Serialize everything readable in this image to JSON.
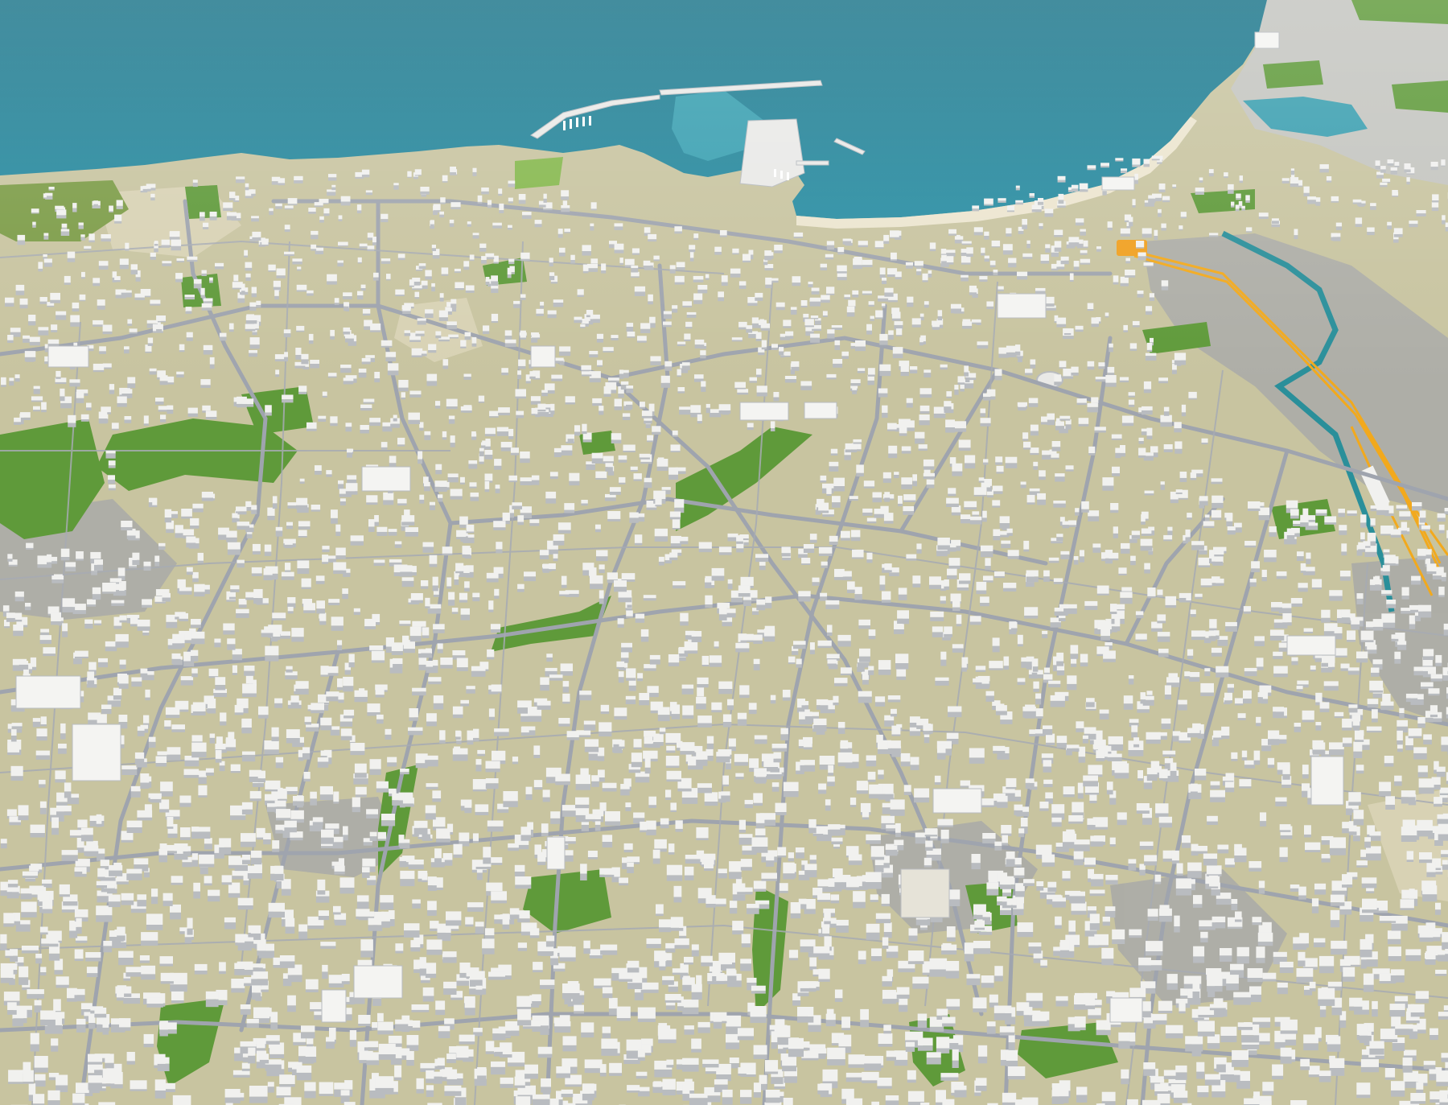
{
  "scene": {
    "kind": "3d-city-model-aerial-view",
    "colors": {
      "sea": "#1f7f95",
      "sea_shallow": "#3fa6b6",
      "land": "#c8c4a0",
      "land_light": "#d8d2b4",
      "gray_zone": "#a9aaa8",
      "road": "#9fa4ae",
      "building": "#f1f1ef",
      "building_shadow": "#b9bcc0",
      "park": "#5f9a3a",
      "park_light": "#86b84e",
      "beach": "#ece5cf",
      "river": "#2a8f9a",
      "rail": "#f2a91d",
      "stadium_roof": "#f0a020"
    },
    "features": [
      "sea",
      "coastline",
      "harbor-piers",
      "marina",
      "beach",
      "river",
      "railway-yard",
      "stadium",
      "parks",
      "road-network",
      "city-blocks",
      "industrial-zone"
    ]
  }
}
